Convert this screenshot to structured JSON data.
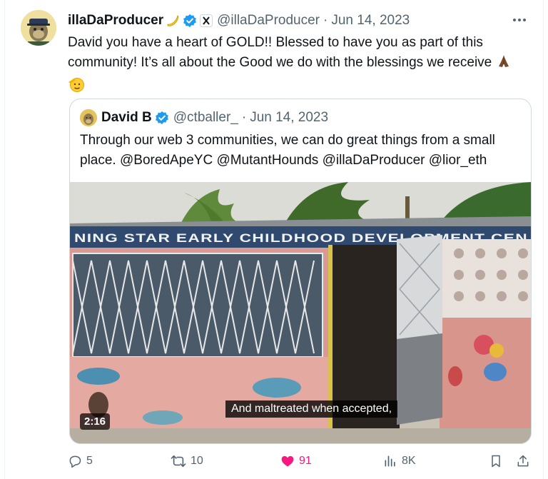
{
  "tweet": {
    "display_name": "illaDaProducer",
    "handle": "@illaDaProducer",
    "separator": "·",
    "date": "Jun 14, 2023",
    "text": "David you have a heart of GOLD!! Blessed to have you as part of this community! It’s all about the Good we do with the blessings we receive",
    "emoji_after_name": "banana-emoji",
    "emoji_end": [
      "folded-hands-emoji",
      "saluting-face-emoji"
    ]
  },
  "quote": {
    "display_name": "David B",
    "handle": "@ctballer_",
    "separator": "·",
    "date": "Jun 14, 2023",
    "text": "Through our web 3 communities, we can do great things from a small place. @BoredApeYC @MutantHounds @illaDaProducer @lior_eth",
    "video": {
      "caption": "And maltreated when accepted,",
      "duration": "2:16",
      "sign_text": "NING STAR EARLY CHILDHOOD DEVELOPMENT CEN"
    }
  },
  "actions": {
    "replies": "5",
    "reposts": "10",
    "likes": "91",
    "views": "8K"
  },
  "colors": {
    "text": "#0f1419",
    "muted": "#536471",
    "verified": "#1d9bf0",
    "like": "#f91880",
    "border": "#cfd9de"
  }
}
